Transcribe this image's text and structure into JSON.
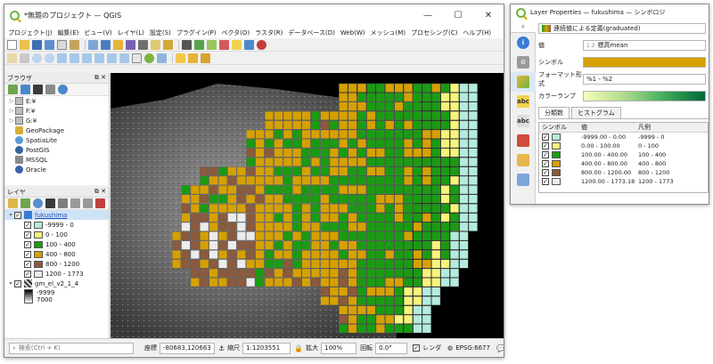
{
  "colors": {
    "c0": "#b3ecde",
    "c1": "#f7f47a",
    "c2": "#1a9c12",
    "c3": "#d6a100",
    "c4": "#8c5a3c",
    "c5": "#ececec",
    "accent": "#3a7bd5",
    "qgis_green": "#6fb33f"
  },
  "qgis": {
    "title": "*無題のプロジェクト — QGIS",
    "menu": [
      "プロジェクト(J)",
      "編集(E)",
      "ビュー(V)",
      "レイヤ(L)",
      "設定(S)",
      "プラグイン(P)",
      "ベクタ(O)",
      "ラスタ(R)",
      "データベース(D)",
      "Web(W)",
      "メッシュ(M)",
      "プロセシング(C)",
      "ヘルプ(H)"
    ],
    "browser": {
      "title": "ブラウザ",
      "items": [
        "E:¥",
        "F:¥",
        "G:¥",
        "GeoPackage",
        "SpatiaLite",
        "PostGIS",
        "MSSQL",
        "Oracle"
      ]
    },
    "layers": {
      "title": "レイヤ",
      "layer1": "fukushima",
      "legend": [
        "-9999 - 0",
        "0 - 100",
        "100 - 400",
        "400 - 800",
        "800 - 1200",
        "1200 - 1773"
      ],
      "layer2": "gm_el_v2_1_4",
      "ramp": [
        "-9999",
        "7000"
      ]
    },
    "status": {
      "search_placeholder": "検索(Ctrl + K)",
      "coord_label": "座標",
      "coord": "-80683,120663",
      "scale_label": "縮尺",
      "scale": "1:1203551",
      "magnifier_label": "拡大",
      "magnifier": "100%",
      "rotation_label": "回転",
      "rotation": "0.0°",
      "render_label": "レンダ",
      "epsg": "EPSG:6677"
    }
  },
  "props": {
    "title": "Layer Properties — fukushima — シンボロジ",
    "renderer": "連続値による定義(graduated)",
    "value_label": "値",
    "value": "標高mean",
    "symbol_label": "シンボル",
    "format_label": "フォーマット形式",
    "format": "%1 - %2",
    "ramp_label": "カラーランプ",
    "tabs": [
      "分類数",
      "ヒストグラム"
    ],
    "columns": [
      "シンボル",
      "値",
      "凡例"
    ],
    "classes": [
      {
        "value": "-9999.00 - 0.00",
        "legend": "-9999 - 0"
      },
      {
        "value": "0.00 - 100.00",
        "legend": "0 - 100"
      },
      {
        "value": "100.00 - 400.00",
        "legend": "100 - 400"
      },
      {
        "value": "400.00 - 800.00",
        "legend": "400 - 800"
      },
      {
        "value": "800.00 - 1200.00",
        "legend": "800 - 1200"
      },
      {
        "value": "1200.00 - 1773.18",
        "legend": "1200 - 1773"
      }
    ]
  }
}
